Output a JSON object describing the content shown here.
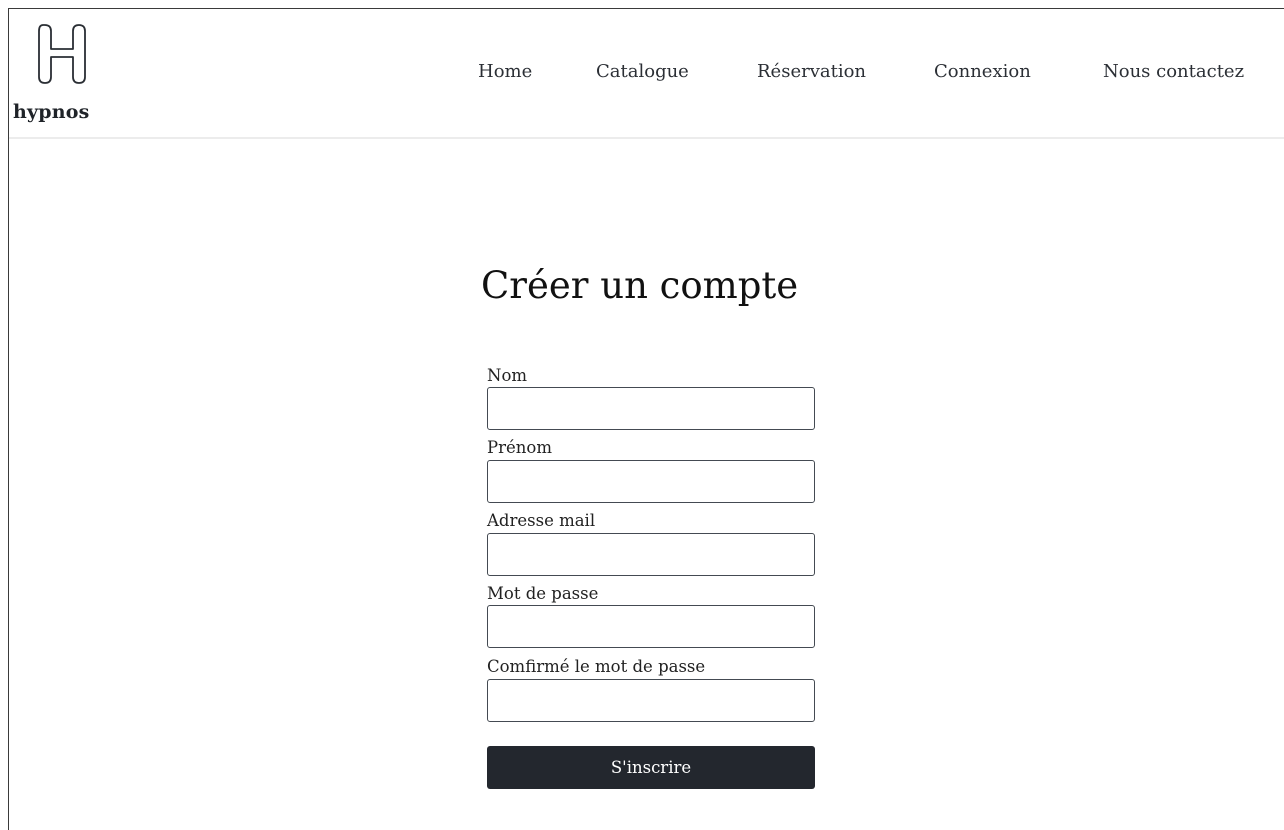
{
  "brand": {
    "logo_icon": "hypnos-h-monogram-icon",
    "name": "hypnos"
  },
  "nav": {
    "items": [
      {
        "label": "Home"
      },
      {
        "label": "Catalogue"
      },
      {
        "label": "Réservation"
      },
      {
        "label": "Connexion"
      },
      {
        "label": "Nous contactez"
      }
    ]
  },
  "form": {
    "title": "Créer un compte",
    "fields": [
      {
        "label": "Nom",
        "value": "",
        "placeholder": ""
      },
      {
        "label": "Prénom",
        "value": "",
        "placeholder": ""
      },
      {
        "label": "Adresse mail",
        "value": "",
        "placeholder": ""
      },
      {
        "label": "Mot de passe",
        "value": "",
        "placeholder": ""
      },
      {
        "label": "Comfirmé le mot de passe",
        "value": "",
        "placeholder": ""
      }
    ],
    "submit_label": "S'inscrire"
  },
  "colors": {
    "button_bg": "#23272e",
    "text": "#1f2328",
    "header_border": "#ececec"
  }
}
